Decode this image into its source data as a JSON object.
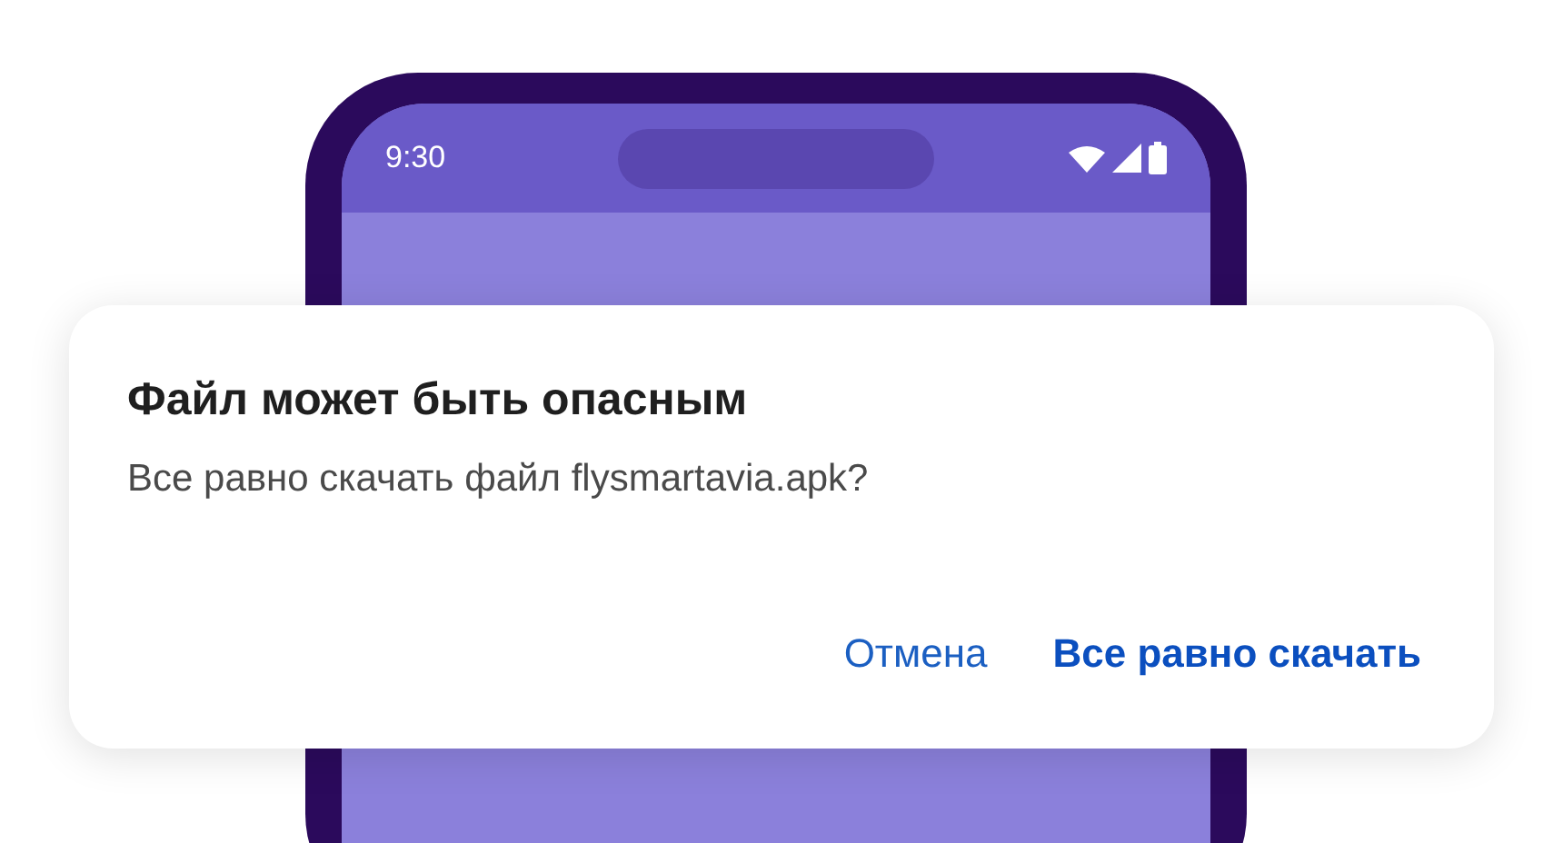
{
  "phone": {
    "status_bar": {
      "time": "9:30"
    }
  },
  "dialog": {
    "title": "Файл может быть опасным",
    "message": "Все равно скачать файл flysmartavia.apk?",
    "buttons": [
      {
        "label": "Отмена",
        "kind": "secondary"
      },
      {
        "label": "Все равно скачать",
        "kind": "primary"
      }
    ]
  }
}
